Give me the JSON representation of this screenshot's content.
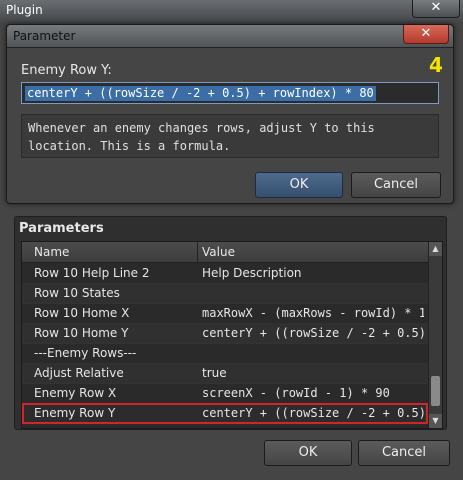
{
  "window": {
    "title": "Plugin",
    "close_glyph": "✕"
  },
  "dialog": {
    "title": "Parameter",
    "close_glyph": "✕",
    "badge": "4",
    "field_label": "Enemy Row Y:",
    "field_value": "centerY + ((rowSize / -2 + 0.5) + rowIndex) * 80",
    "help_text": "Whenever an enemy changes rows, adjust Y to this location. This is a formula.",
    "ok_label": "OK",
    "cancel_label": "Cancel"
  },
  "parameters": {
    "title": "Parameters",
    "columns": [
      "Name",
      "Value"
    ],
    "rows": [
      {
        "name": "Row 10 Help Line 2",
        "value": "Help Description"
      },
      {
        "name": "Row 10 States",
        "value": ""
      },
      {
        "name": "Row 10 Home X",
        "value": "maxRowX - (maxRows - rowId) * 1…"
      },
      {
        "name": "Row 10 Home Y",
        "value": "centerY + ((rowSize / -2 + 0.5)…"
      },
      {
        "name": "---Enemy Rows---",
        "value": ""
      },
      {
        "name": "Adjust Relative",
        "value": "true"
      },
      {
        "name": "Enemy Row X",
        "value": "screenX - (rowId - 1) * 90"
      },
      {
        "name": "Enemy Row Y",
        "value": "centerY + ((rowSize / -2 + 0.5)…"
      }
    ],
    "selected_index": 7,
    "ok_label": "OK",
    "cancel_label": "Cancel"
  },
  "icons": {
    "scroll_up": "▲",
    "scroll_down": "▼"
  },
  "colors": {
    "highlight_border": "#d2252a",
    "badge": "#f4e400",
    "selection": "#3b6ea6"
  }
}
